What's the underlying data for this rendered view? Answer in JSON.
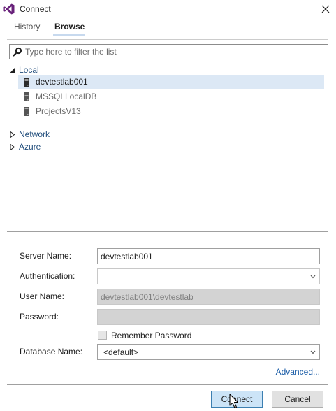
{
  "window": {
    "title": "Connect",
    "logo_icon": "visual-studio-logo-icon",
    "close_icon": "close-icon"
  },
  "tabs": [
    {
      "label": "History",
      "active": false
    },
    {
      "label": "Browse",
      "active": true
    }
  ],
  "filter": {
    "placeholder": "Type here to filter the list",
    "value": "",
    "icon": "search-icon"
  },
  "tree": {
    "groups": [
      {
        "label": "Local",
        "expanded": true,
        "items": [
          {
            "label": "devtestlab001",
            "selected": true
          },
          {
            "label": "MSSQLLocalDB",
            "selected": false
          },
          {
            "label": "ProjectsV13",
            "selected": false
          }
        ]
      },
      {
        "label": "Network",
        "expanded": false,
        "items": []
      },
      {
        "label": "Azure",
        "expanded": false,
        "items": []
      }
    ]
  },
  "form": {
    "server_name": {
      "label": "Server Name:",
      "value": "devtestlab001"
    },
    "authentication": {
      "label": "Authentication:",
      "value": ""
    },
    "user_name": {
      "label": "User Name:",
      "value": "devtestlab001\\devtestlab"
    },
    "password": {
      "label": "Password:",
      "value": ""
    },
    "remember_password": {
      "label": "Remember Password",
      "checked": false
    },
    "database_name": {
      "label": "Database Name:",
      "value": "<default>"
    }
  },
  "advanced_label": "Advanced...",
  "buttons": {
    "connect": "Connect",
    "cancel": "Cancel"
  },
  "colors": {
    "accent": "#3c7fb1",
    "selection": "#dce8f5",
    "link": "#1e5fa8",
    "vs_purple": "#68217a"
  }
}
